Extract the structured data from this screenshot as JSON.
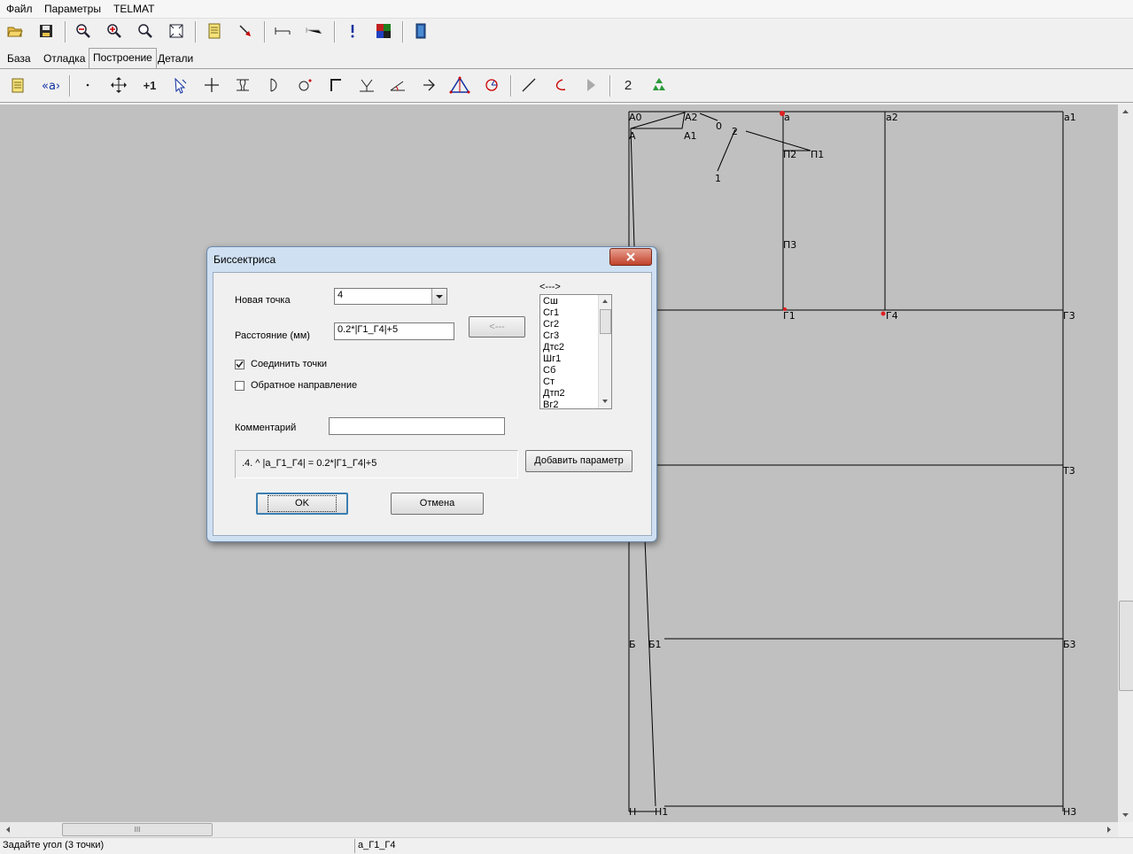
{
  "menu": [
    "Файл",
    "Параметры",
    "TELMAT"
  ],
  "tabs": [
    "База",
    "Отладка",
    "Построение",
    "Детали"
  ],
  "active_tab": "Построение",
  "toolbar2": {
    "num_button": "2",
    "plus_one": "+1"
  },
  "points": [
    {
      "name": "A0",
      "label": "А0"
    },
    {
      "name": "A2",
      "label": "А2"
    },
    {
      "name": "a",
      "label": "а"
    },
    {
      "name": "a2",
      "label": "а2"
    },
    {
      "name": "a1",
      "label": "а1"
    },
    {
      "name": "A",
      "label": "А"
    },
    {
      "name": "A1",
      "label": "А1"
    },
    {
      "name": "p0",
      "label": "0"
    },
    {
      "name": "p2",
      "label": "2"
    },
    {
      "name": "p1",
      "label": "1"
    },
    {
      "name": "P2",
      "label": "П2"
    },
    {
      "name": "P1",
      "label": "П1"
    },
    {
      "name": "P3",
      "label": "П3"
    },
    {
      "name": "G1",
      "label": "Г1"
    },
    {
      "name": "G4",
      "label": "Г4"
    },
    {
      "name": "G3",
      "label": "Г3"
    },
    {
      "name": "T3",
      "label": "Т3"
    },
    {
      "name": "B",
      "label": "Б"
    },
    {
      "name": "B1",
      "label": "Б1"
    },
    {
      "name": "B3",
      "label": "Б3"
    },
    {
      "name": "H",
      "label": "Н"
    },
    {
      "name": "H1",
      "label": "Н1"
    },
    {
      "name": "H3",
      "label": "Н3"
    }
  ],
  "dialog": {
    "title": "Биссектриса",
    "new_point_label": "Новая точка",
    "new_point_value": "4",
    "distance_label": "Расстояние (мм)",
    "distance_value": "0.2*|Г1_Г4|+5",
    "arrow_button": "<---",
    "connect_label": "Соединить точки",
    "connect_checked": true,
    "reverse_label": "Обратное направление",
    "reverse_checked": false,
    "comment_label": "Комментарий",
    "comment_value": "",
    "formula": ".4. ^ |а_Г1_Г4| = 0.2*|Г1_Г4|+5",
    "add_param_button": "Добавить параметр",
    "ok_button": "OK",
    "cancel_button": "Отмена",
    "params_header": "<--->",
    "params": [
      "Сш",
      "Сг1",
      "Сг2",
      "Сг3",
      "Дтс2",
      "Шг1",
      "Сб",
      "Ст",
      "Дтп2",
      "Вг2"
    ]
  },
  "hscroll_grip": "III",
  "status": {
    "left": "Задайте угол (3 точки)",
    "right": "а_Г1_Г4"
  }
}
